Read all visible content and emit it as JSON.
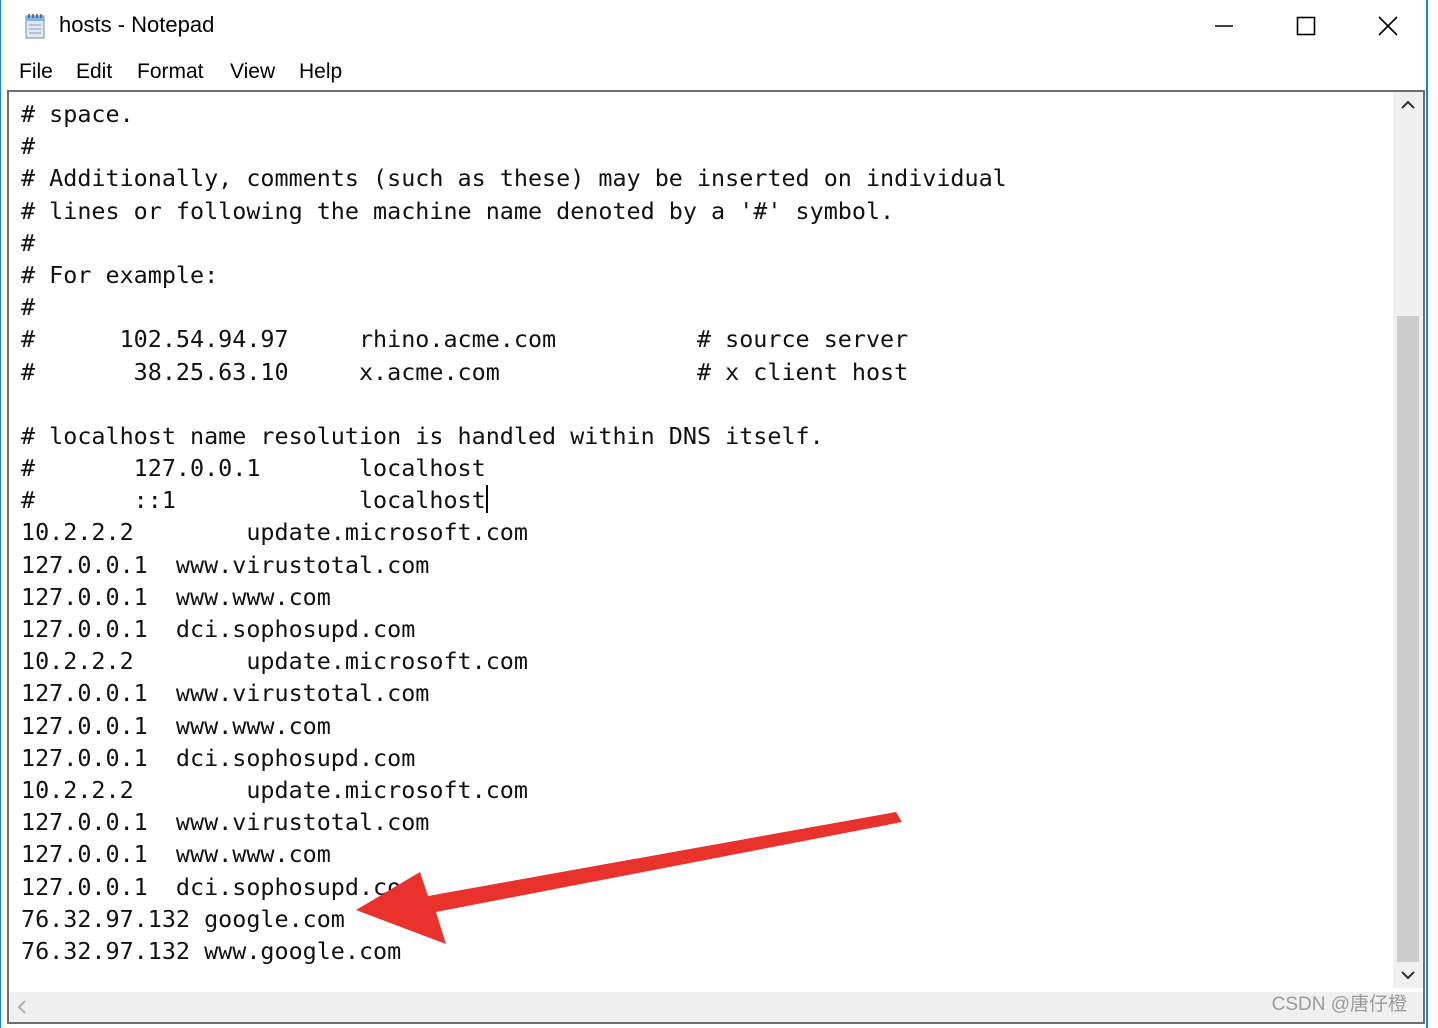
{
  "window": {
    "title": "hosts - Notepad"
  },
  "menu": [
    "File",
    "Edit",
    "Format",
    "View",
    "Help"
  ],
  "editor": {
    "lines": [
      "# space.",
      "#",
      "# Additionally, comments (such as these) may be inserted on individual",
      "# lines or following the machine name denoted by a '#' symbol.",
      "#",
      "# For example:",
      "#",
      "#      102.54.94.97     rhino.acme.com          # source server",
      "#       38.25.63.10     x.acme.com              # x client host",
      "",
      "# localhost name resolution is handled within DNS itself.",
      "#       127.0.0.1       localhost",
      "#       ::1             localhost",
      "10.2.2.2        update.microsoft.com",
      "127.0.0.1  www.virustotal.com",
      "127.0.0.1  www.www.com",
      "127.0.0.1  dci.sophosupd.com",
      "10.2.2.2        update.microsoft.com",
      "127.0.0.1  www.virustotal.com",
      "127.0.0.1  www.www.com",
      "127.0.0.1  dci.sophosupd.com",
      "10.2.2.2        update.microsoft.com",
      "127.0.0.1  www.virustotal.com",
      "127.0.0.1  www.www.com",
      "127.0.0.1  dci.sophosupd.com",
      "76.32.97.132 google.com",
      "76.32.97.132 www.google.com"
    ],
    "caret_line": 12
  },
  "watermark": "CSDN @唐仔橙",
  "annotation": {
    "arrow_color": "#e8322b"
  }
}
